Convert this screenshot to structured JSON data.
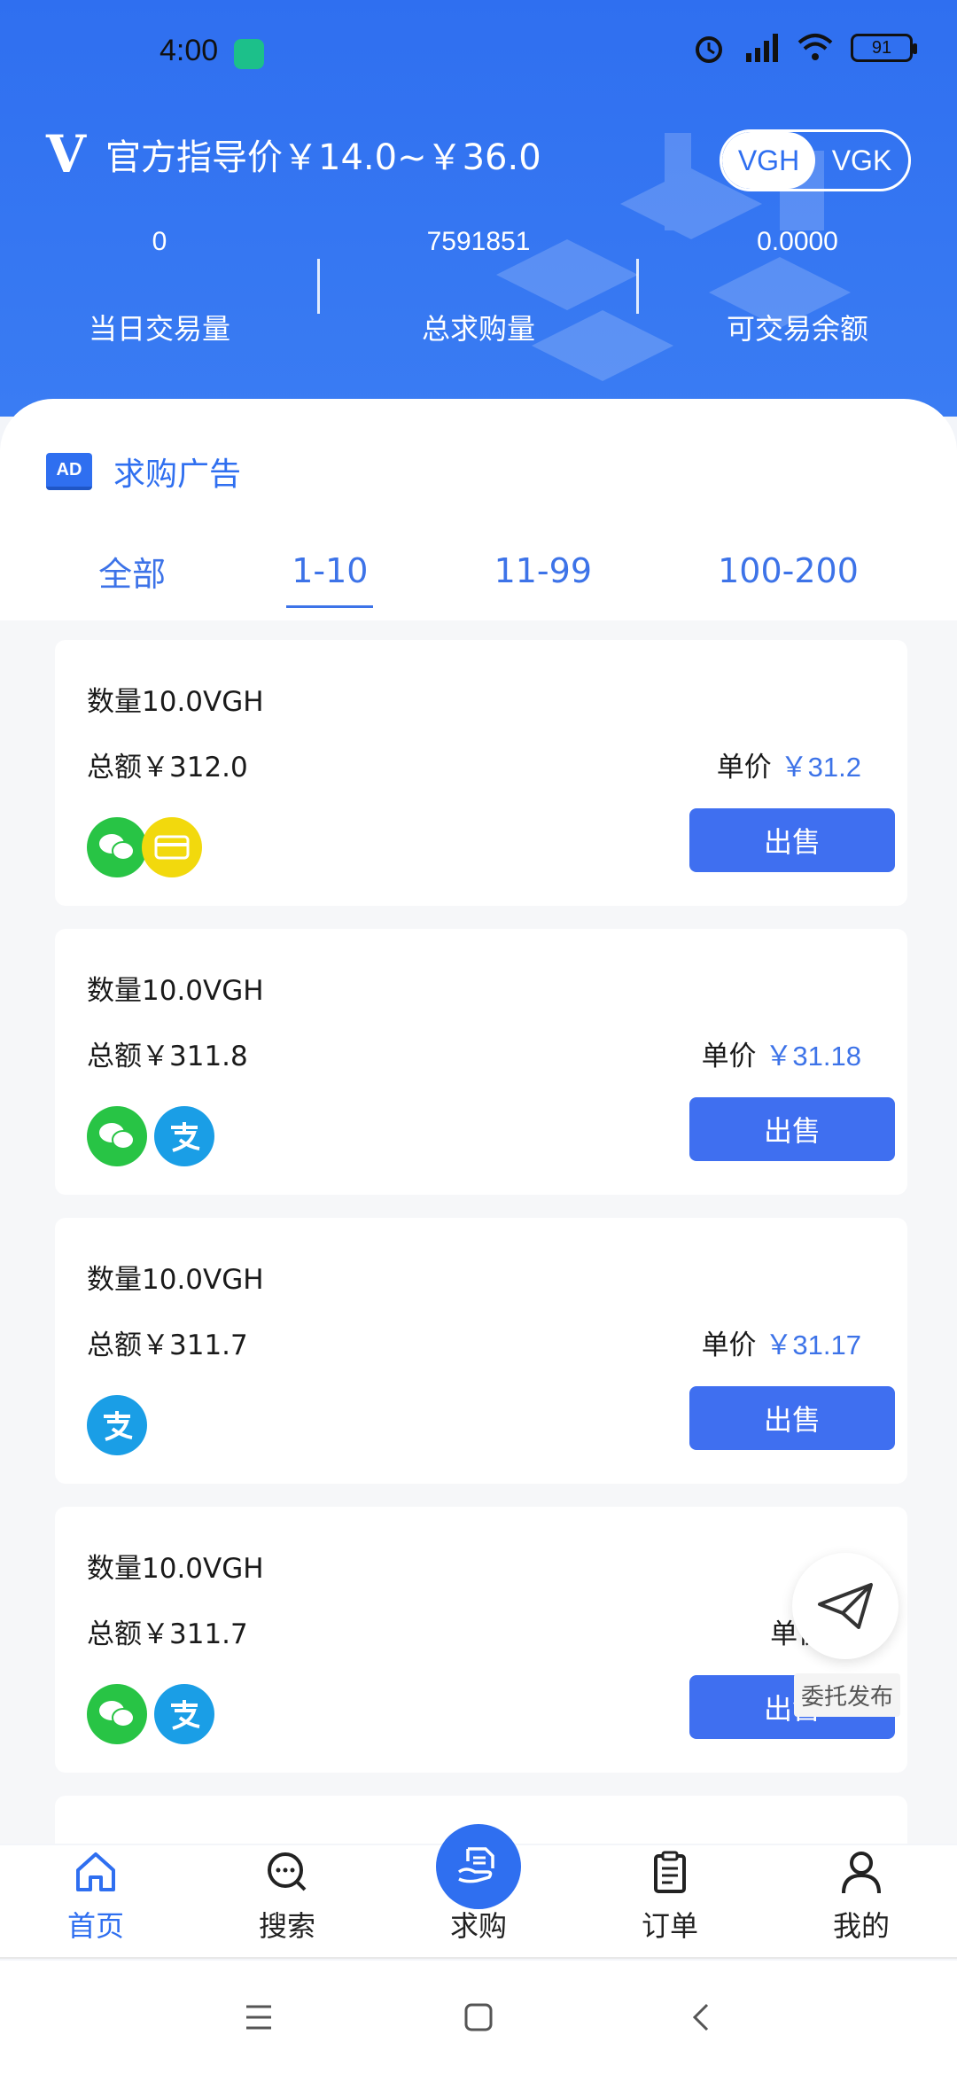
{
  "status_bar": {
    "time": "4:00",
    "battery": "91"
  },
  "header": {
    "logo": "V",
    "guide_price": "官方指导价￥14.0~￥36.0",
    "toggle": [
      "VGH",
      "VGK"
    ]
  },
  "stats": [
    {
      "value": "0",
      "label": "当日交易量"
    },
    {
      "value": "7591851",
      "label": "总求购量"
    },
    {
      "value": "0.0000",
      "label": "可交易余额"
    }
  ],
  "ad_section": {
    "badge": "AD",
    "title": "求购广告"
  },
  "filter_tabs": [
    "全部",
    "1-10",
    "11-99",
    "100-200"
  ],
  "cards": [
    {
      "quantity": "数量10.0VGH",
      "total": "总额￥312.0",
      "unit_label": "单价",
      "unit_price": "￥31.2",
      "payments": [
        "wechat-pay-icon",
        "bank-card-icon"
      ],
      "action": "出售"
    },
    {
      "quantity": "数量10.0VGH",
      "total": "总额￥311.8",
      "unit_label": "单价",
      "unit_price": "￥31.18",
      "payments": [
        "wechat-pay-icon",
        "alipay-icon"
      ],
      "action": "出售"
    },
    {
      "quantity": "数量10.0VGH",
      "total": "总额￥311.7",
      "unit_label": "单价",
      "unit_price": "￥31.17",
      "payments": [
        "alipay-icon"
      ],
      "action": "出售"
    },
    {
      "quantity": "数量10.0VGH",
      "total": "总额￥311.7",
      "unit_label": "单价",
      "unit_price": "￥",
      "payments": [
        "wechat-pay-icon",
        "alipay-icon"
      ],
      "action": "出售"
    }
  ],
  "float_button": {
    "label": "委托发布",
    "icon": "paper-plane-icon"
  },
  "bottom_nav": [
    {
      "label": "首页",
      "icon": "home-icon",
      "active": true
    },
    {
      "label": "搜索",
      "icon": "search-icon",
      "active": false
    },
    {
      "label": "求购",
      "icon": "purchase-icon",
      "active": false
    },
    {
      "label": "订单",
      "icon": "clipboard-icon",
      "active": false
    },
    {
      "label": "我的",
      "icon": "user-icon",
      "active": false
    }
  ],
  "colors": {
    "primary": "#2f6ff0",
    "price": "#3d73e8",
    "wechat": "#28c445",
    "alipay": "#1a9ee6",
    "card": "#f2d90d"
  }
}
